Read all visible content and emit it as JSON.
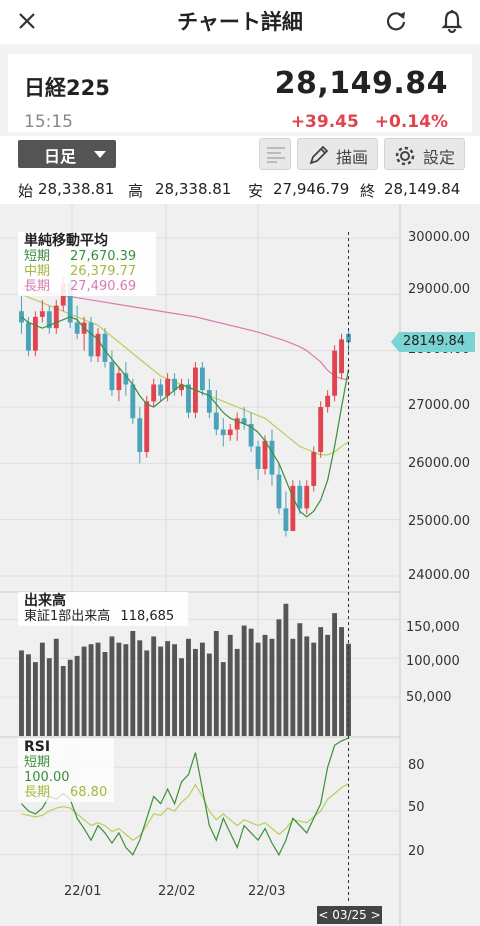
{
  "header": {
    "title": "チャート詳細",
    "close_icon": "close-icon",
    "refresh_icon": "refresh-icon",
    "bell_icon": "bell-icon"
  },
  "quote": {
    "symbol": "日経225",
    "time": "15:15",
    "price": "28,149.84",
    "change": "+39.45",
    "change_pct": "+0.14%",
    "up_color": "#e0454f"
  },
  "toolbar": {
    "period": "日足",
    "draw_label": "描画",
    "settings_label": "設定"
  },
  "ohlc": {
    "open_label": "始",
    "open": "28,338.81",
    "high_label": "高",
    "high": "28,338.81",
    "low_label": "安",
    "low": "27,946.79",
    "close_label": "終",
    "close": "28,149.84"
  },
  "ma_legend": {
    "title": "単純移動平均",
    "short_label": "短期",
    "short_value": "27,670.39",
    "mid_label": "中期",
    "mid_value": "26,379.77",
    "long_label": "長期",
    "long_value": "27,490.69"
  },
  "volume_legend": {
    "title": "出来高",
    "subtitle": "東証1部出来高",
    "value": "118,685"
  },
  "rsi_legend": {
    "title": "RSI",
    "short_label": "短期",
    "short_value": "100.00",
    "long_label": "長期",
    "long_value": "68.80"
  },
  "current_price_tag": "28149.84",
  "crosshair_date": "< 03/25 >",
  "chart_data": {
    "type": "line",
    "price_ticks": [
      "30000.00",
      "29000.00",
      "28000.00",
      "27000.00",
      "26000.00",
      "25000.00",
      "24000.00"
    ],
    "price_ylim": [
      24000,
      30000
    ],
    "volume_ticks": [
      "150,000",
      "100,000",
      "50,000"
    ],
    "rsi_ticks": [
      "80",
      "50",
      "20"
    ],
    "x_ticks": [
      "22/01",
      "22/02",
      "22/03"
    ],
    "colors": {
      "up": "#e0454f",
      "down": "#4aa3b8",
      "ma_short": "#3a8f3a",
      "ma_mid": "#b8cf5a",
      "ma_long": "#d97bb0",
      "volume": "#555555",
      "rsi_short": "#3a8f3a",
      "rsi_long": "#b8cf5a"
    },
    "candles": [
      [
        28700,
        29000,
        28300,
        28500
      ],
      [
        28500,
        28600,
        27900,
        28000
      ],
      [
        28000,
        28700,
        27900,
        28600
      ],
      [
        28600,
        28900,
        28500,
        28700
      ],
      [
        28700,
        28800,
        28300,
        28400
      ],
      [
        28400,
        28900,
        28300,
        28800
      ],
      [
        28800,
        29300,
        28700,
        29200
      ],
      [
        29200,
        29300,
        28400,
        28500
      ],
      [
        28500,
        28800,
        28200,
        28300
      ],
      [
        28300,
        28600,
        28000,
        28500
      ],
      [
        28500,
        28600,
        27800,
        27900
      ],
      [
        27900,
        28400,
        27800,
        28300
      ],
      [
        28300,
        28400,
        27700,
        27800
      ],
      [
        27800,
        28000,
        27200,
        27300
      ],
      [
        27300,
        27700,
        27100,
        27600
      ],
      [
        27600,
        27800,
        27200,
        27400
      ],
      [
        27400,
        27500,
        26700,
        26800
      ],
      [
        26800,
        27000,
        26000,
        26200
      ],
      [
        26200,
        27200,
        26100,
        27100
      ],
      [
        27100,
        27500,
        27000,
        27400
      ],
      [
        27400,
        27500,
        27100,
        27200
      ],
      [
        27200,
        27600,
        27100,
        27500
      ],
      [
        27500,
        27600,
        27200,
        27300
      ],
      [
        27300,
        27500,
        27200,
        27400
      ],
      [
        27400,
        27500,
        26800,
        26900
      ],
      [
        26900,
        27800,
        26800,
        27700
      ],
      [
        27700,
        27800,
        27200,
        27300
      ],
      [
        27300,
        27500,
        26800,
        26900
      ],
      [
        26900,
        27300,
        26500,
        26600
      ],
      [
        26600,
        26800,
        26300,
        26500
      ],
      [
        26500,
        26700,
        26400,
        26600
      ],
      [
        26600,
        26900,
        26400,
        26800
      ],
      [
        26800,
        27000,
        26600,
        26700
      ],
      [
        26700,
        26900,
        26200,
        26300
      ],
      [
        26300,
        26400,
        25700,
        25900
      ],
      [
        25900,
        26500,
        25800,
        26400
      ],
      [
        26400,
        26600,
        25600,
        25800
      ],
      [
        25800,
        26000,
        25100,
        25200
      ],
      [
        25200,
        25500,
        24700,
        24800
      ],
      [
        24800,
        25700,
        24800,
        25600
      ],
      [
        25600,
        25700,
        25100,
        25200
      ],
      [
        25200,
        25700,
        25100,
        25600
      ],
      [
        25600,
        26300,
        25500,
        26200
      ],
      [
        26200,
        27100,
        26100,
        27000
      ],
      [
        27000,
        27300,
        26900,
        27200
      ],
      [
        27200,
        28100,
        27100,
        28000
      ],
      [
        27600,
        28300,
        27500,
        28200
      ],
      [
        28300,
        28350,
        27950,
        28150
      ]
    ],
    "ma_short": [
      28600,
      28500,
      28450,
      28400,
      28450,
      28500,
      28550,
      28600,
      28550,
      28400,
      28300,
      28200,
      28000,
      27850,
      27700,
      27550,
      27400,
      27200,
      27050,
      27000,
      27100,
      27200,
      27300,
      27400,
      27350,
      27300,
      27250,
      27200,
      27050,
      26900,
      26800,
      26750,
      26700,
      26650,
      26550,
      26400,
      26200,
      26000,
      25700,
      25400,
      25150,
      25050,
      25150,
      25350,
      25700,
      26300,
      27000,
      27670
    ],
    "ma_mid": [
      29000,
      28950,
      28900,
      28850,
      28800,
      28750,
      28700,
      28650,
      28600,
      28550,
      28500,
      28450,
      28350,
      28250,
      28150,
      28050,
      27950,
      27850,
      27750,
      27650,
      27550,
      27500,
      27450,
      27400,
      27350,
      27300,
      27250,
      27200,
      27150,
      27100,
      27050,
      27000,
      26950,
      26900,
      26850,
      26800,
      26700,
      26600,
      26500,
      26400,
      26300,
      26250,
      26200,
      26150,
      26150,
      26200,
      26300,
      26380
    ],
    "ma_long": [
      29100,
      29080,
      29060,
      29040,
      29020,
      29000,
      28980,
      28960,
      28940,
      28920,
      28900,
      28880,
      28860,
      28840,
      28820,
      28800,
      28780,
      28760,
      28740,
      28720,
      28700,
      28680,
      28660,
      28640,
      28620,
      28600,
      28570,
      28540,
      28510,
      28480,
      28450,
      28420,
      28390,
      28360,
      28330,
      28290,
      28250,
      28210,
      28170,
      28120,
      28070,
      28000,
      27900,
      27800,
      27650,
      27550,
      27500,
      27491
    ],
    "volume": [
      110000,
      105000,
      95000,
      120000,
      100000,
      125000,
      90000,
      98000,
      103000,
      115000,
      118000,
      120000,
      108000,
      128000,
      120000,
      118000,
      135000,
      123000,
      110000,
      128000,
      115000,
      122000,
      118000,
      100000,
      125000,
      112000,
      120000,
      106000,
      135000,
      95000,
      130000,
      112000,
      142000,
      138000,
      120000,
      130000,
      125000,
      150000,
      170000,
      125000,
      145000,
      128000,
      120000,
      140000,
      130000,
      158000,
      140000,
      118685
    ],
    "rsi_short": [
      55,
      50,
      48,
      52,
      60,
      58,
      62,
      58,
      45,
      38,
      30,
      40,
      35,
      28,
      35,
      25,
      20,
      30,
      45,
      60,
      55,
      65,
      55,
      70,
      75,
      90,
      65,
      40,
      30,
      45,
      35,
      25,
      40,
      35,
      30,
      38,
      28,
      20,
      30,
      45,
      40,
      35,
      45,
      55,
      80,
      95,
      98,
      100
    ],
    "rsi_long": [
      48,
      47,
      46,
      47,
      50,
      52,
      53,
      52,
      48,
      44,
      40,
      42,
      40,
      36,
      38,
      34,
      30,
      33,
      40,
      48,
      47,
      52,
      50,
      56,
      60,
      68,
      60,
      50,
      44,
      48,
      44,
      40,
      44,
      42,
      40,
      42,
      38,
      34,
      38,
      44,
      43,
      42,
      46,
      50,
      58,
      62,
      66,
      68.8
    ]
  }
}
